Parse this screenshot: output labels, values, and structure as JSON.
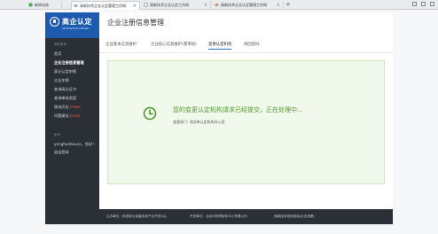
{
  "browser": {
    "tabs": [
      {
        "label": "新闻动态",
        "active": false
      },
      {
        "label": "高新技术企业认定管理工作网",
        "active": true
      },
      {
        "label": "高新技术企业认定工作网",
        "active": false
      },
      {
        "label": "高新技术企业认定管理工作网",
        "active": false
      }
    ],
    "new_tab_label": "+"
  },
  "sidebar": {
    "logo_title": "高企认定",
    "logo_subtitle": "RECOGNITION COMPANY",
    "section_main": "导航菜单",
    "items": [
      {
        "label": "首页"
      },
      {
        "label": "企业注册信息管理",
        "active": true
      },
      {
        "label": "高企认定申报"
      },
      {
        "label": "企业年报"
      },
      {
        "label": "查询高企证书"
      },
      {
        "label": "查询审核进度"
      },
      {
        "label": "版本历史",
        "badge": "(new)"
      },
      {
        "label": "问题建议",
        "badge": "(new)"
      }
    ],
    "section_account": "帐号",
    "user_greeting": "yonghushouce，您好！",
    "logout_label": "退出登录"
  },
  "header": {
    "title": "企业注册信息管理"
  },
  "subtabs": [
    {
      "label": "企业基本信息维护"
    },
    {
      "label": "企业核心信息维护(需审核)"
    },
    {
      "label": "变更认定机构",
      "active": true
    },
    {
      "label": "找回密码"
    }
  ],
  "notice": {
    "message": "您的变更认定机构请求已经提交，正在处理中...",
    "detail": "变更部门: 测试单认定机构办公室",
    "accent_color": "#4d9a2a"
  },
  "footer": {
    "host_label": "主办单位：科技部火炬高技术产业开发中心",
    "dev_label": "开发单位：北京中科院软件中心有限公司",
    "support_label": "网络技术咨询电话(点击查看)"
  }
}
